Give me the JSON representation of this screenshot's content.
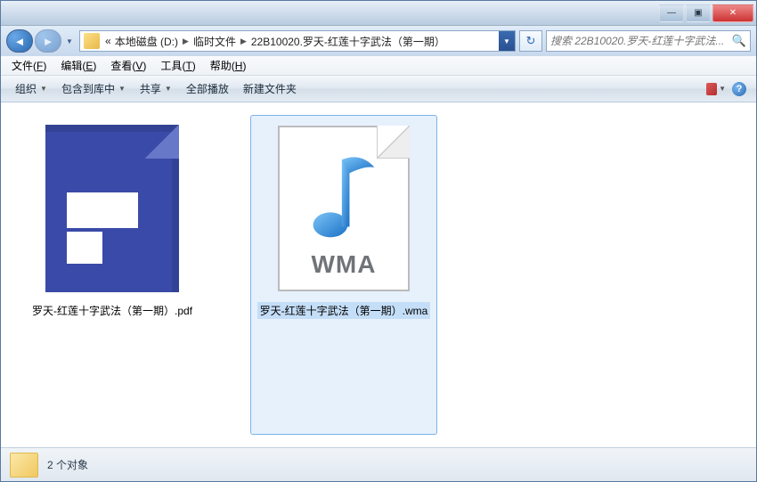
{
  "titlebar": {
    "min": "—",
    "max": "▣",
    "close": "✕"
  },
  "nav": {
    "back": "◄",
    "forward": "►"
  },
  "breadcrumb": {
    "prefix": "«",
    "parts": [
      "本地磁盘 (D:)",
      "临时文件",
      "22B10020.罗天-红莲十字武法（第一期）"
    ]
  },
  "search": {
    "placeholder": "搜索 22B10020.罗天-红莲十字武法..."
  },
  "menubar": {
    "file": "文件",
    "file_hot": "F",
    "edit": "编辑",
    "edit_hot": "E",
    "view": "查看",
    "view_hot": "V",
    "tools": "工具",
    "tools_hot": "T",
    "help": "帮助",
    "help_hot": "H"
  },
  "toolbar": {
    "organize": "组织",
    "include": "包含到库中",
    "share": "共享",
    "playall": "全部播放",
    "newfolder": "新建文件夹"
  },
  "files": [
    {
      "name": "罗天-红莲十字武法（第一期）.pdf",
      "type": "pdf",
      "selected": false
    },
    {
      "name": "罗天-红莲十字武法（第一期）.wma",
      "type": "wma",
      "selected": true
    }
  ],
  "wma_label": "WMA",
  "statusbar": {
    "count_text": "2 个对象"
  }
}
